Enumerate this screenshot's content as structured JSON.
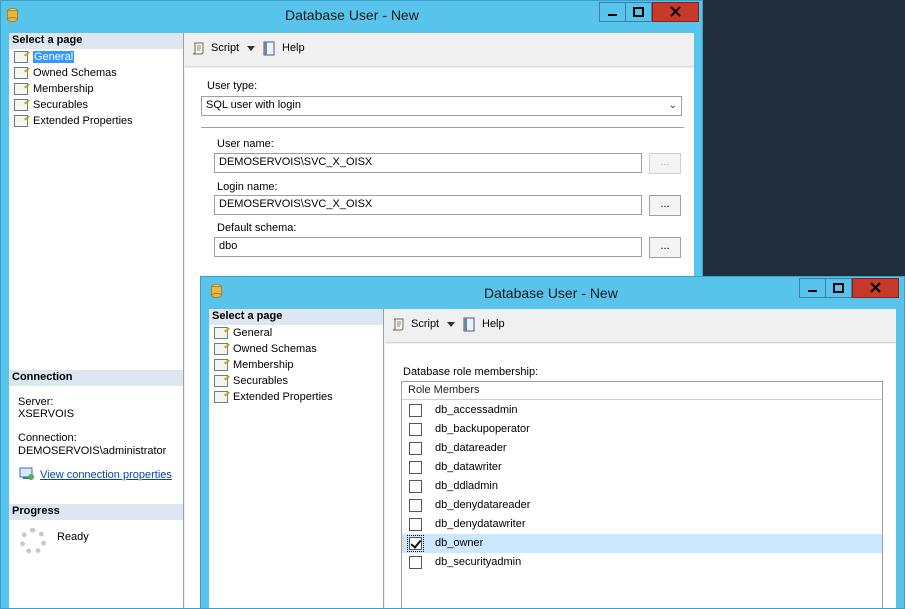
{
  "window1": {
    "title": "Database User - New",
    "select_a_page": "Select a page",
    "pages": [
      "General",
      "Owned Schemas",
      "Membership",
      "Securables",
      "Extended Properties"
    ],
    "selected_page": 0,
    "toolbar": {
      "script": "Script",
      "help": "Help"
    },
    "user_type_label": "User type:",
    "user_type_value": "SQL user with login",
    "user_name_label": "User name:",
    "user_name_value": "DEMOSERVOIS\\SVC_X_OISX",
    "login_name_label": "Login name:",
    "login_name_value": "DEMOSERVOIS\\SVC_X_OISX",
    "default_schema_label": "Default schema:",
    "default_schema_value": "dbo",
    "ellipsis": "...",
    "connection": {
      "header": "Connection",
      "server_label": "Server:",
      "server_value": "XSERVOIS",
      "connection_label": "Connection:",
      "connection_value": "DEMOSERVOIS\\administrator",
      "view_link": "View connection properties"
    },
    "progress": {
      "header": "Progress",
      "status": "Ready"
    }
  },
  "window2": {
    "title": "Database User - New",
    "select_a_page": "Select a page",
    "pages": [
      "General",
      "Owned Schemas",
      "Membership",
      "Securables",
      "Extended Properties"
    ],
    "toolbar": {
      "script": "Script",
      "help": "Help"
    },
    "role_membership_label": "Database role membership:",
    "column_header": "Role Members",
    "roles": [
      {
        "name": "db_accessadmin",
        "checked": false
      },
      {
        "name": "db_backupoperator",
        "checked": false
      },
      {
        "name": "db_datareader",
        "checked": false
      },
      {
        "name": "db_datawriter",
        "checked": false
      },
      {
        "name": "db_ddladmin",
        "checked": false
      },
      {
        "name": "db_denydatareader",
        "checked": false
      },
      {
        "name": "db_denydatawriter",
        "checked": false
      },
      {
        "name": "db_owner",
        "checked": true
      },
      {
        "name": "db_securityadmin",
        "checked": false
      }
    ]
  },
  "colors": {
    "titlebar": "#58c4ec",
    "close": "#c7392b",
    "selection": "#3399ff",
    "row_highlight": "#cce8ff",
    "desktop": "#1f2d3d"
  },
  "icons": {
    "app": "database-cylinder-icon",
    "page": "page-properties-icon",
    "script": "script-icon",
    "help": "help-book-icon"
  }
}
